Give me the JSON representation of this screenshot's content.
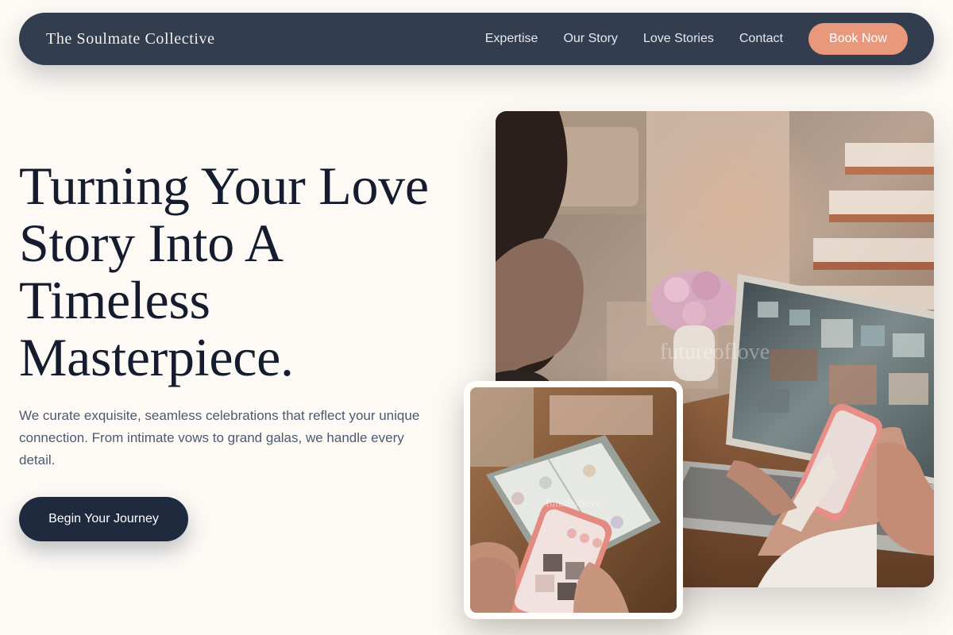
{
  "header": {
    "brand": "The Soulmate Collective",
    "nav": [
      {
        "label": "Expertise"
      },
      {
        "label": "Our Story"
      },
      {
        "label": "Love Stories"
      },
      {
        "label": "Contact"
      }
    ],
    "book_label": "Book Now"
  },
  "hero": {
    "headline": "Turning Your Love Story Into A Timeless Masterpiece.",
    "subtext": "We curate exquisite, seamless celebrations that reflect your unique connection. From intimate vows to grand galas, we handle every detail.",
    "cta_label": "Begin Your Journey"
  },
  "images": {
    "main_watermark": "futureoflove",
    "small_watermark": "futureoflove"
  },
  "colors": {
    "nav_bg": "#323d4f",
    "accent": "#e9987c",
    "cta_bg": "#1f2a3e",
    "page_bg": "#fdfaf6",
    "heading": "#141c2e"
  }
}
